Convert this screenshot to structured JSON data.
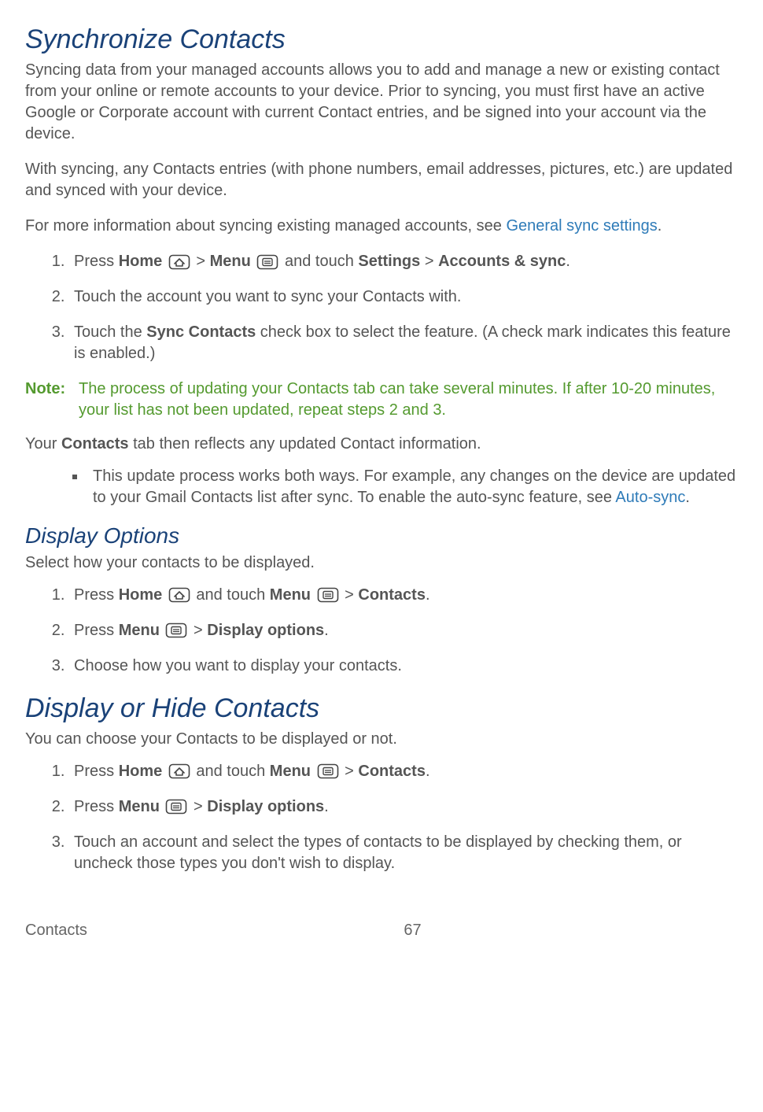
{
  "sections": {
    "sync": {
      "title": "Synchronize Contacts",
      "para1": "Syncing data from your managed accounts allows you to add and manage a new or existing contact from your online or remote accounts to your device. Prior to syncing, you must first have an active Google or Corporate account with current Contact entries, and be signed into your account via the device.",
      "para2": "With syncing, any Contacts entries (with phone numbers, email addresses, pictures, etc.) are updated and synced with your device.",
      "para3_pre": "For more information about syncing existing managed accounts, see ",
      "para3_link": "General sync settings",
      "para3_post": ".",
      "steps": {
        "s1": {
          "press": "Press ",
          "home": "Home",
          "gt1": " > ",
          "menu": "Menu",
          "mid": " and touch ",
          "settings": "Settings",
          "gt2": " > ",
          "accounts": "Accounts & sync",
          "end": "."
        },
        "s2": "Touch the account you want to sync your Contacts with.",
        "s3": {
          "pre": "Touch the ",
          "bold": "Sync Contacts",
          "post": " check box to select the feature. (A check mark indicates this feature is enabled.)"
        }
      },
      "note_label": "Note:",
      "note_text": "The process of updating your Contacts tab can take several minutes. If after 10-20 minutes, your list has not been updated, repeat steps 2 and 3.",
      "after": {
        "pre": "Your ",
        "bold": "Contacts",
        "post": " tab then reflects any updated Contact information."
      },
      "bullet": {
        "pre": "This update process works both ways. For example, any changes on the device are updated to your Gmail Contacts list after sync. To enable the auto-sync feature, see ",
        "link": "Auto-sync",
        "post": "."
      }
    },
    "display_options": {
      "title": "Display Options",
      "intro": "Select how your contacts to be displayed.",
      "steps": {
        "s1": {
          "press": "Press ",
          "home": "Home",
          "mid": " and touch ",
          "menu": "Menu",
          "gt": " > ",
          "contacts": "Contacts",
          "end": "."
        },
        "s2": {
          "press": "Press ",
          "menu": "Menu",
          "gt": " > ",
          "opt": "Display options",
          "end": "."
        },
        "s3": "Choose how you want to display your contacts."
      }
    },
    "display_hide": {
      "title": "Display or Hide Contacts",
      "intro": "You can choose your Contacts to be displayed or not.",
      "steps": {
        "s1": {
          "press": "Press ",
          "home": "Home",
          "mid": " and touch ",
          "menu": "Menu",
          "gt": " > ",
          "contacts": "Contacts",
          "end": "."
        },
        "s2": {
          "press": "Press ",
          "menu": "Menu",
          "gt": " > ",
          "opt": "Display options",
          "end": "."
        },
        "s3": "Touch an account and select the types of contacts to be displayed by checking them, or uncheck those types you don't wish to display."
      }
    }
  },
  "footer": {
    "left": "Contacts",
    "center": "67"
  }
}
